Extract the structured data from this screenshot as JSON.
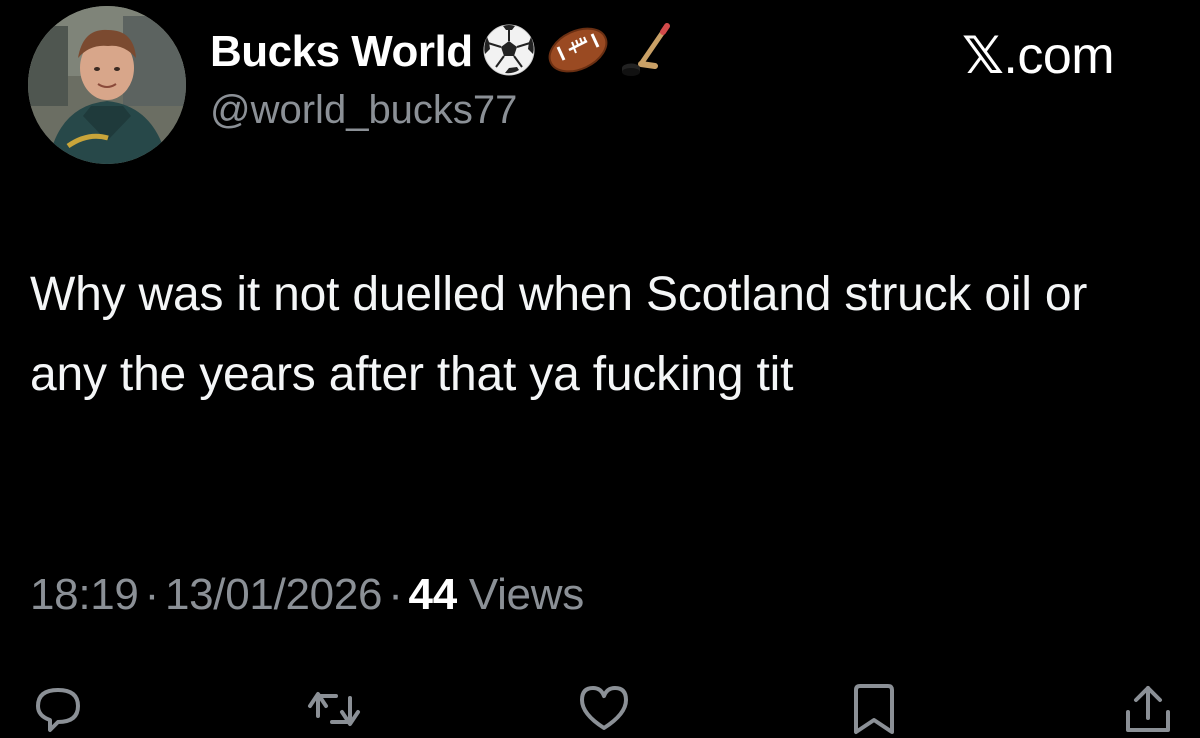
{
  "user": {
    "display_name": "Bucks World",
    "handle": "@world_bucks77",
    "name_emojis": [
      "soccer-ball-icon",
      "american-football-icon",
      "hockey-stick-icon"
    ]
  },
  "brand": {
    "x_mark": "𝕏",
    "domain": ".com"
  },
  "tweet": {
    "text": "Why was it not duelled when Scotland struck oil or any the years after that ya fucking tit"
  },
  "meta": {
    "time": "18:19",
    "separator": "·",
    "date": "13/01/2026",
    "views_count": "44",
    "views_label": "Views"
  },
  "actions": [
    "reply-icon",
    "retweet-icon",
    "like-icon",
    "bookmark-icon",
    "share-icon"
  ],
  "colors": {
    "background": "#000000",
    "text": "#e7e9ea",
    "secondary": "#8b9096"
  }
}
